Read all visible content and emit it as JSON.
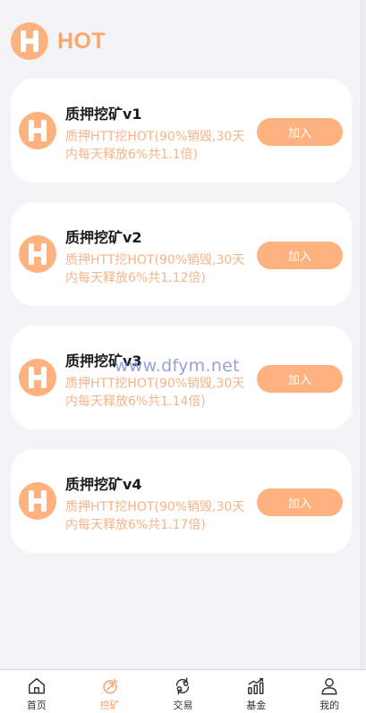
{
  "header": {
    "title": "HOT",
    "logo_icon": "hot-logo-icon"
  },
  "products": [
    {
      "title": "质押挖矿v1",
      "description": "质押HTT挖HOT(90%销毁,30天内每天释放6%共1.1倍)",
      "button": "加入"
    },
    {
      "title": "质押挖矿v2",
      "description": "质押HTT挖HOT(90%销毁,30天内每天释放6%共1.12倍)",
      "button": "加入"
    },
    {
      "title": "质押挖矿v3",
      "description": "质押HTT挖HOT(90%销毁,30天内每天释放6%共1.14倍)",
      "button": "加入"
    },
    {
      "title": "质押挖矿v4",
      "description": "质押HTT挖HOT(90%销毁,30天内每天释放6%共1.17倍)",
      "button": "加入"
    }
  ],
  "watermark": "www.dfym.net",
  "tabbar": {
    "active": "挖矿",
    "items": [
      {
        "label": "首页",
        "icon": "home-icon"
      },
      {
        "label": "挖矿",
        "icon": "mining-icon"
      },
      {
        "label": "交易",
        "icon": "exchange-icon"
      },
      {
        "label": "基金",
        "icon": "fund-chart-icon"
      },
      {
        "label": "我的",
        "icon": "user-icon"
      }
    ]
  },
  "colors": {
    "accent": "#fdb27f",
    "accent_text": "#f7b48a",
    "background": "#f4f4f6"
  }
}
